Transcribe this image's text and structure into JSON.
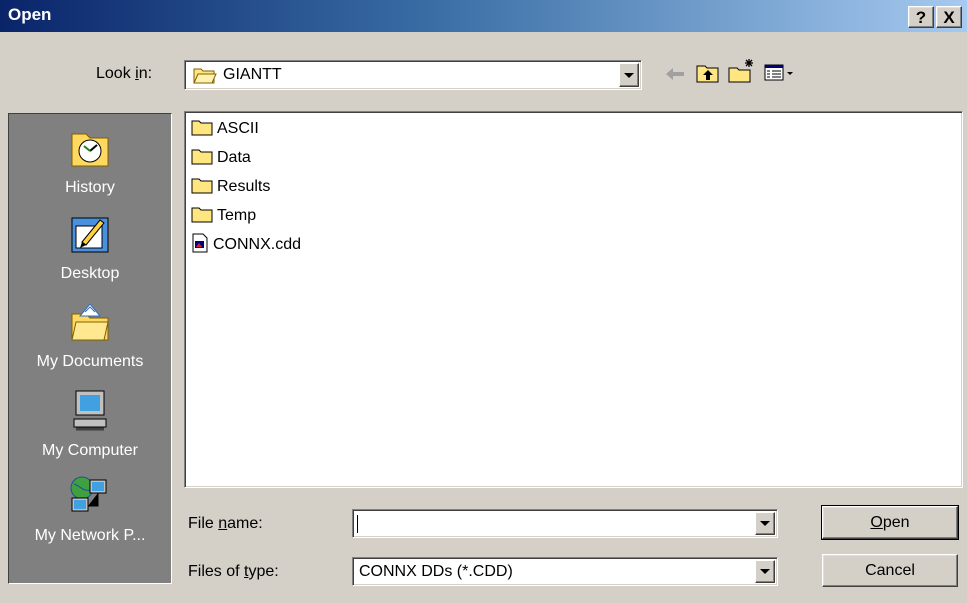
{
  "window": {
    "title": "Open",
    "help_glyph": "?",
    "close_glyph": "X"
  },
  "lookin": {
    "label_pre": "Look ",
    "label_key": "i",
    "label_post": "n:",
    "value": "GIANTT"
  },
  "toolbar": [
    {
      "name": "back-arrow-icon"
    },
    {
      "name": "up-one-level-icon"
    },
    {
      "name": "create-new-folder-icon"
    },
    {
      "name": "view-menu-icon"
    }
  ],
  "places": [
    {
      "label": "History",
      "icon": "history-icon"
    },
    {
      "label": "Desktop",
      "icon": "desktop-icon"
    },
    {
      "label": "My Documents",
      "icon": "my-documents-icon"
    },
    {
      "label": "My Computer",
      "icon": "my-computer-icon"
    },
    {
      "label": "My Network P...",
      "icon": "my-network-places-icon"
    }
  ],
  "files": [
    {
      "name": "ASCII",
      "type": "folder"
    },
    {
      "name": "Data",
      "type": "folder"
    },
    {
      "name": "Results",
      "type": "folder"
    },
    {
      "name": "Temp",
      "type": "folder"
    },
    {
      "name": "CONNX.cdd",
      "type": "file"
    }
  ],
  "filename": {
    "label_pre": "File ",
    "label_key": "n",
    "label_post": "ame:",
    "value": ""
  },
  "filetype": {
    "label_pre": "Files of ",
    "label_key": "t",
    "label_post": "ype:",
    "value": "CONNX DDs (*.CDD)"
  },
  "buttons": {
    "open": {
      "key": "O",
      "rest": "pen"
    },
    "cancel": "Cancel"
  }
}
